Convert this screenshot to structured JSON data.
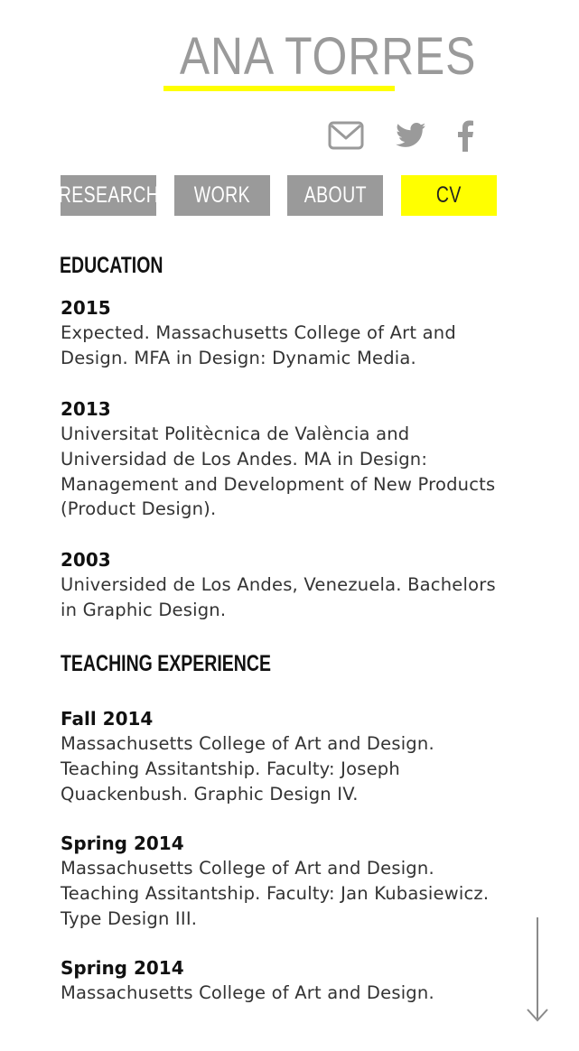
{
  "header": {
    "site_title": "ANA TORRES"
  },
  "social": {
    "email_icon": "envelope-icon",
    "twitter_icon": "twitter-bird-icon",
    "facebook_icon": "facebook-f-icon"
  },
  "nav": {
    "items": [
      {
        "label": "RESEARCH",
        "active": false
      },
      {
        "label": "WORK",
        "active": false
      },
      {
        "label": "ABOUT",
        "active": false
      },
      {
        "label": "CV",
        "active": true
      }
    ]
  },
  "education": {
    "heading": "EDUCATION",
    "entries": [
      {
        "year": "2015",
        "text": "Expected. Massachusetts College of Art and Design. MFA in Design: Dynamic Media."
      },
      {
        "year": "2013",
        "text": "Universitat Politècnica de València and Universidad de Los Andes. MA in Design: Management and Development of New Products (Product Design)."
      },
      {
        "year": "2003",
        "text": "Universided de Los Andes, Venezuela. Bachelors in Graphic Design."
      }
    ]
  },
  "teaching": {
    "heading": "TEACHING EXPERIENCE",
    "entries": [
      {
        "year": "Fall 2014",
        "text": "Massachusetts College of Art and Design. Teaching Assitantship. Faculty: Joseph Quackenbush. Graphic Design IV."
      },
      {
        "year": "Spring 2014",
        "text": "Massachusetts College of Art and Design. Teaching Assitantship. Faculty: Jan Kubasiewicz. Type Design III."
      },
      {
        "year": "Spring 2014",
        "text": "Massachusetts College of Art and Design."
      }
    ]
  },
  "scroll": {
    "icon": "arrow-down-icon"
  },
  "colors": {
    "accent": "#ffff00",
    "nav_gray": "#9a9a9a",
    "text": "#111111"
  }
}
